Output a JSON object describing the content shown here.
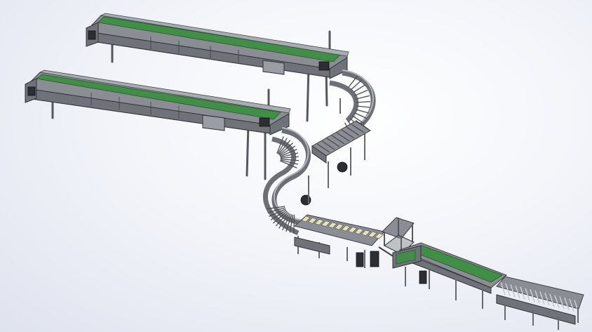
{
  "scene": {
    "subject": "",
    "colors": {
      "background_center": "#ffffff",
      "background_edge": "#dfe3ee",
      "frame": "#8a8d93",
      "belt": "#3f8f45",
      "motor": "#2c2e33"
    }
  }
}
